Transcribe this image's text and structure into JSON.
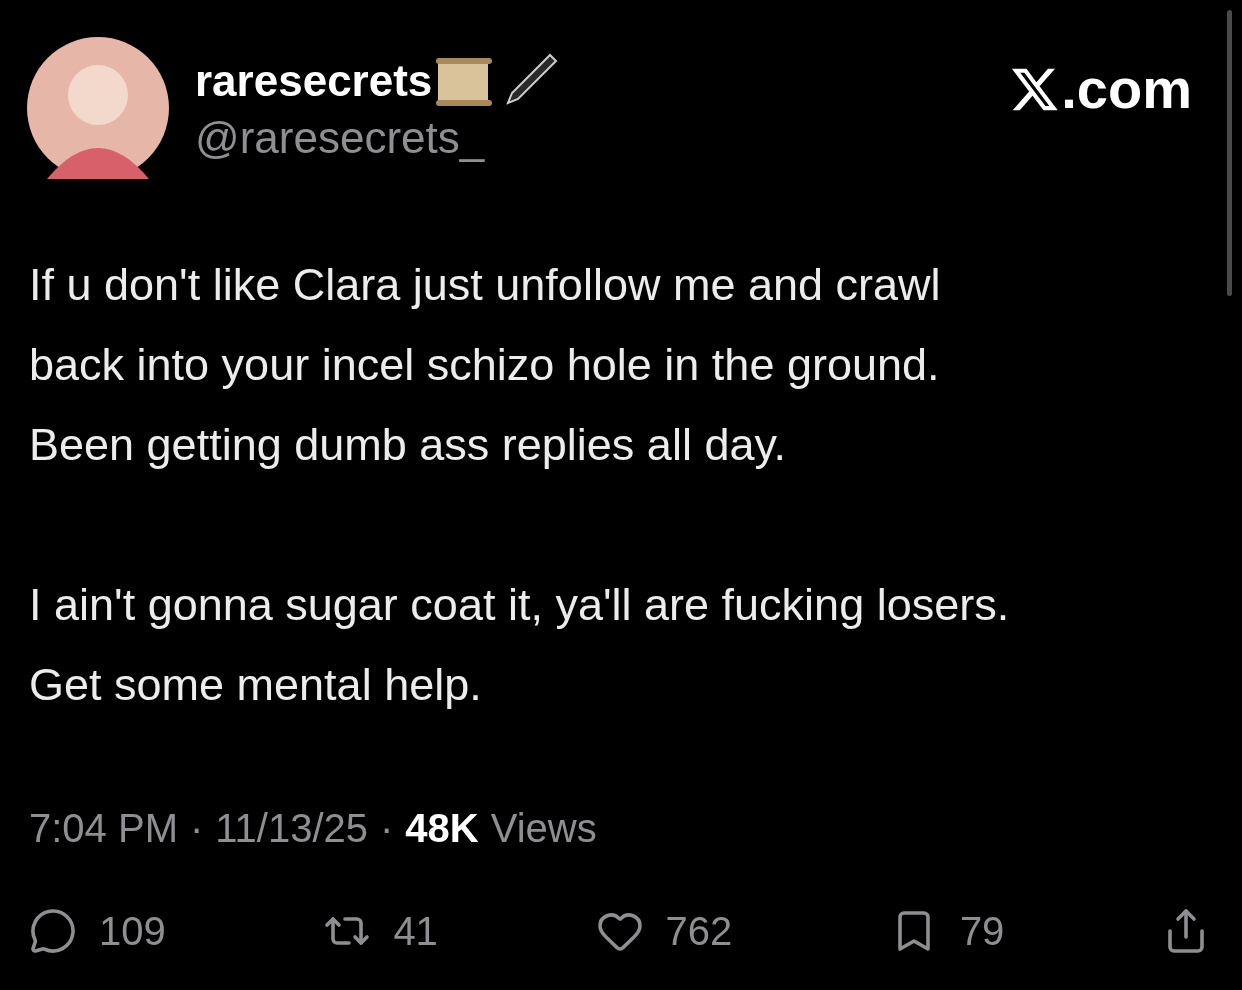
{
  "author": {
    "name": "raresecrets",
    "handle": "@raresecrets_"
  },
  "brand": {
    "suffix": ".com"
  },
  "body": [
    [
      "If u don't like Clara just unfollow me and crawl",
      "back into your incel schizo hole in the ground.",
      "Been getting dumb ass replies all day."
    ],
    [
      "I ain't gonna sugar coat it, ya'll are fucking losers.",
      "Get some mental help."
    ]
  ],
  "meta": [
    {
      "kind": "plain",
      "text": "7:04 PM"
    },
    {
      "kind": "separator",
      "text": "·"
    },
    {
      "kind": "plain",
      "text": "11/13/25"
    },
    {
      "kind": "separator",
      "text": "·"
    },
    {
      "kind": "bold",
      "text": "48K"
    },
    {
      "kind": "plain",
      "text": "Views"
    }
  ],
  "actions": [
    {
      "kind": "reply",
      "count": "109"
    },
    {
      "kind": "repost",
      "count": "41"
    },
    {
      "kind": "like",
      "count": "762"
    },
    {
      "kind": "bookmark",
      "count": "79"
    },
    {
      "kind": "share"
    }
  ]
}
